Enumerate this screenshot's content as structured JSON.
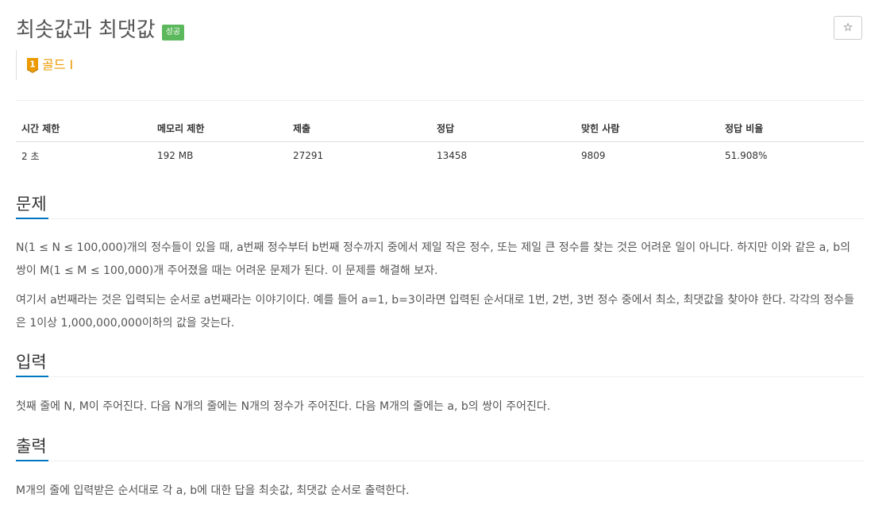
{
  "problem": {
    "title": "최솟값과 최댓값",
    "result_badge": "성공",
    "star_label": "☆",
    "tier_number": "1",
    "tier_label": "골드 I"
  },
  "info_table": {
    "headers": [
      "시간 제한",
      "메모리 제한",
      "제출",
      "정답",
      "맞힌 사람",
      "정답 비율"
    ],
    "values": [
      "2 초",
      "192 MB",
      "27291",
      "13458",
      "9809",
      "51.908%"
    ]
  },
  "sections": {
    "description": {
      "heading": "문제",
      "paragraphs": [
        "N(1 ≤ N ≤ 100,000)개의 정수들이 있을 때, a번째 정수부터 b번째 정수까지 중에서 제일 작은 정수, 또는 제일 큰 정수를 찾는 것은 어려운 일이 아니다. 하지만 이와 같은 a, b의 쌍이 M(1 ≤ M ≤ 100,000)개 주어졌을 때는 어려운 문제가 된다. 이 문제를 해결해 보자.",
        "여기서 a번째라는 것은 입력되는 순서로 a번째라는 이야기이다. 예를 들어 a=1, b=3이라면 입력된 순서대로 1번, 2번, 3번 정수 중에서 최소, 최댓값을 찾아야 한다. 각각의 정수들은 1이상 1,000,000,000이하의 값을 갖는다."
      ]
    },
    "input": {
      "heading": "입력",
      "paragraphs": [
        "첫째 줄에 N, M이 주어진다. 다음 N개의 줄에는 N개의 정수가 주어진다. 다음 M개의 줄에는 a, b의 쌍이 주어진다."
      ]
    },
    "output": {
      "heading": "출력",
      "paragraphs": [
        "M개의 줄에 입력받은 순서대로 각 a, b에 대한 답을 최솟값, 최댓값 순서로 출력한다."
      ]
    }
  },
  "colors": {
    "accent": "#0076c0",
    "success_badge": "#5cb85c",
    "gold_tier": "#ec9a00"
  }
}
